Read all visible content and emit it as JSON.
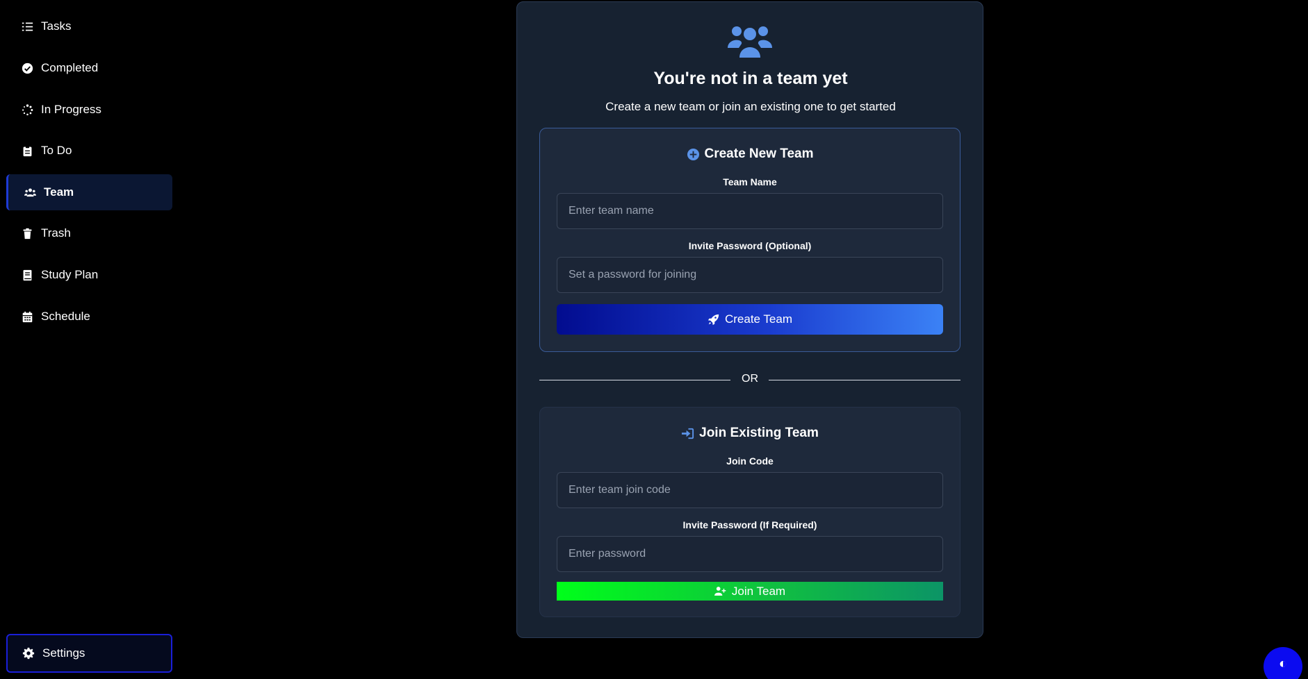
{
  "sidebar": {
    "items": [
      {
        "label": "Tasks",
        "icon": "tasks-list-icon"
      },
      {
        "label": "Completed",
        "icon": "check-circle-icon"
      },
      {
        "label": "In Progress",
        "icon": "spinner-icon"
      },
      {
        "label": "To Do",
        "icon": "clipboard-icon"
      },
      {
        "label": "Team",
        "icon": "users-icon",
        "active": true
      },
      {
        "label": "Trash",
        "icon": "trash-icon"
      },
      {
        "label": "Study Plan",
        "icon": "book-icon"
      },
      {
        "label": "Schedule",
        "icon": "calendar-icon"
      }
    ],
    "settings_label": "Settings"
  },
  "main": {
    "headline": "You're not in a team yet",
    "subline": "Create a new team or join an existing one to get started",
    "create": {
      "title": "Create New Team",
      "team_name_label": "Team Name",
      "team_name_placeholder": "Enter team name",
      "password_label": "Invite Password (Optional)",
      "password_placeholder": "Set a password for joining",
      "button_label": "Create Team"
    },
    "divider_text": "OR",
    "join": {
      "title": "Join Existing Team",
      "code_label": "Join Code",
      "code_placeholder": "Enter team join code",
      "password_label": "Invite Password (If Required)",
      "password_placeholder": "Enter password",
      "button_label": "Join Team"
    }
  },
  "theme_toggle_glyph": "◐",
  "colors": {
    "accent_blue": "#3b82f6",
    "active_border": "#1e3bd6",
    "join_green": "#00ff1a",
    "card_bg": "#172231"
  }
}
